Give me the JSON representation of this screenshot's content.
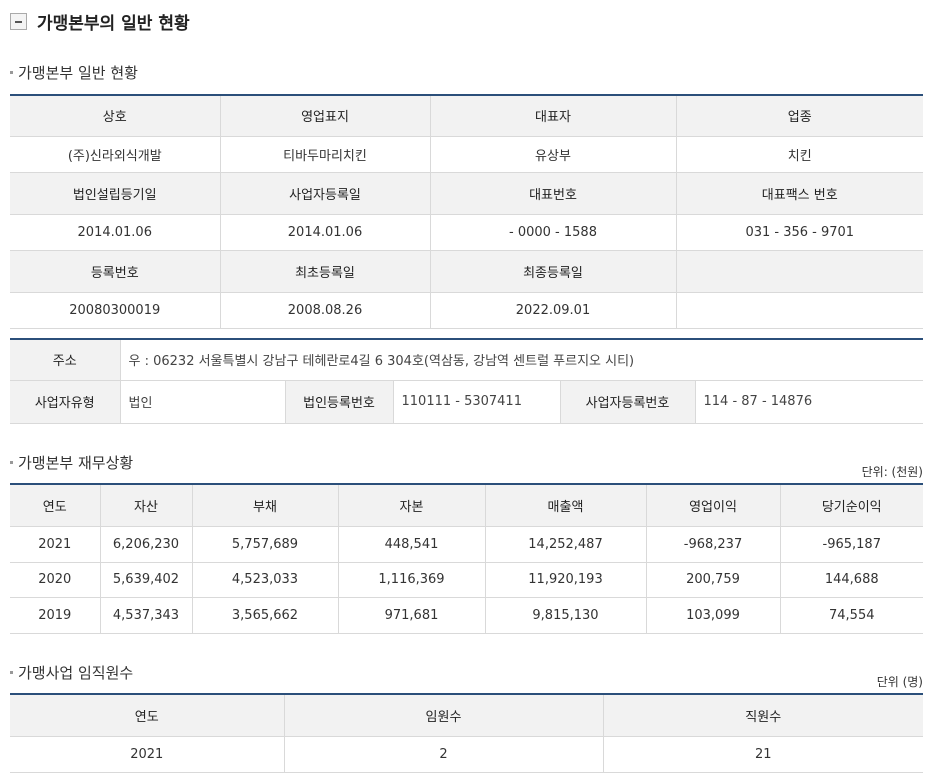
{
  "page": {
    "title": "가맹본부의 일반 현황"
  },
  "general": {
    "title": "가맹본부 일반 현황",
    "row1_headers": [
      "상호",
      "영업표지",
      "대표자",
      "업종"
    ],
    "row1_values": [
      "(주)신라외식개발",
      "티바두마리치킨",
      "유상부",
      "치킨"
    ],
    "row2_headers": [
      "법인설립등기일",
      "사업자등록일",
      "대표번호",
      "대표팩스 번호"
    ],
    "row2_values": [
      "2014.01.06",
      "2014.01.06",
      "-  0000  -  1588",
      "031  -  356  -  9701"
    ],
    "row3_headers": [
      "등록번호",
      "최초등록일",
      "최종등록일",
      ""
    ],
    "row3_values": [
      "20080300019",
      "2008.08.26",
      "2022.09.01",
      ""
    ]
  },
  "address": {
    "address_label": "주소",
    "address_value": "우 : 06232 서울특별시 강남구 테헤란로4길 6 304호(역삼동, 강남역 센트럴 푸르지오 시티)",
    "biz_type_label": "사업자유형",
    "biz_type_value": "법인",
    "corp_no_label": "법인등록번호",
    "corp_no_value": "110111  -  5307411",
    "biz_no_label": "사업자등록번호",
    "biz_no_value": "114  -  87  -  14876"
  },
  "finance": {
    "title": "가맹본부 재무상황",
    "unit": "단위: (천원)",
    "headers": [
      "연도",
      "자산",
      "부채",
      "자본",
      "매출액",
      "영업이익",
      "당기순이익"
    ],
    "rows": [
      [
        "2021",
        "6,206,230",
        "5,757,689",
        "448,541",
        "14,252,487",
        "-968,237",
        "-965,187"
      ],
      [
        "2020",
        "5,639,402",
        "4,523,033",
        "1,116,369",
        "11,920,193",
        "200,759",
        "144,688"
      ],
      [
        "2019",
        "4,537,343",
        "3,565,662",
        "971,681",
        "9,815,130",
        "103,099",
        "74,554"
      ]
    ]
  },
  "staff": {
    "title": "가맹사업 임직원수",
    "unit": "단위 (명)",
    "headers": [
      "연도",
      "임원수",
      "직원수"
    ],
    "rows": [
      [
        "2021",
        "2",
        "21"
      ]
    ]
  }
}
